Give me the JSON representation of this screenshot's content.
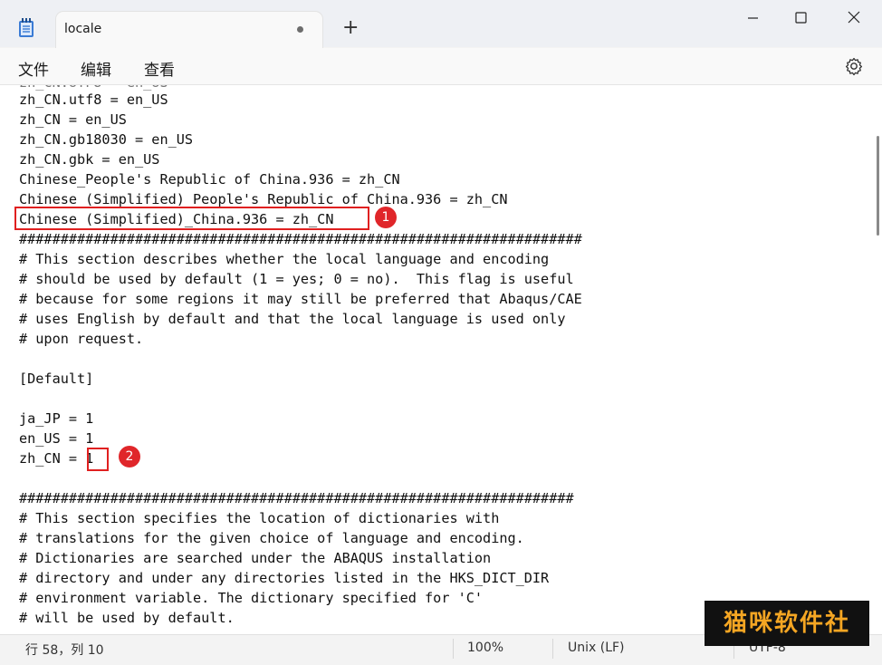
{
  "window": {
    "tab_title": "locale",
    "new_tab_symbol": "+",
    "icons": [
      "notepad-icon",
      "unsaved-dot-icon",
      "new-tab-icon",
      "minimize-icon",
      "maximize-icon",
      "close-icon"
    ]
  },
  "menu": {
    "file": "文件",
    "edit": "编辑",
    "view": "查看",
    "settings_icon": "gear-icon"
  },
  "editor": {
    "lines": [
      "zh_CN.utf8 = en_US",
      "zh_CN = en_US",
      "zh_CN.gb18030 = en_US",
      "zh_CN.gbk = en_US",
      "Chinese_People's Republic of China.936 = zh_CN",
      "Chinese (Simplified) People's Republic of China.936 = zh_CN",
      "Chinese (Simplified)_China.936 = zh_CN",
      "####################################################################",
      "# This section describes whether the local language and encoding",
      "# should be used by default (1 = yes; 0 = no).  This flag is useful",
      "# because for some regions it may still be preferred that Abaqus/CAE",
      "# uses English by default and that the local language is used only",
      "# upon request.",
      "",
      "[Default]",
      "",
      "ja_JP = 1",
      "en_US = 1",
      "zh_CN = 1",
      "",
      "###################################################################",
      "# This section specifies the location of dictionaries with",
      "# translations for the given choice of language and encoding.",
      "# Dictionaries are searched under the ABAQUS installation",
      "# directory and under any directories listed in the HKS_DICT_DIR",
      "# environment variable. The dictionary specified for 'C'",
      "# will be used by default."
    ],
    "annotations": [
      {
        "number": "1",
        "color": "#e0262a"
      },
      {
        "number": "2",
        "color": "#e0262a"
      }
    ]
  },
  "status": {
    "position": "行 58，列 10",
    "zoom": "100%",
    "line_ending": "Unix (LF)",
    "encoding": "UTF-8"
  },
  "watermark": "猫咪软件社"
}
